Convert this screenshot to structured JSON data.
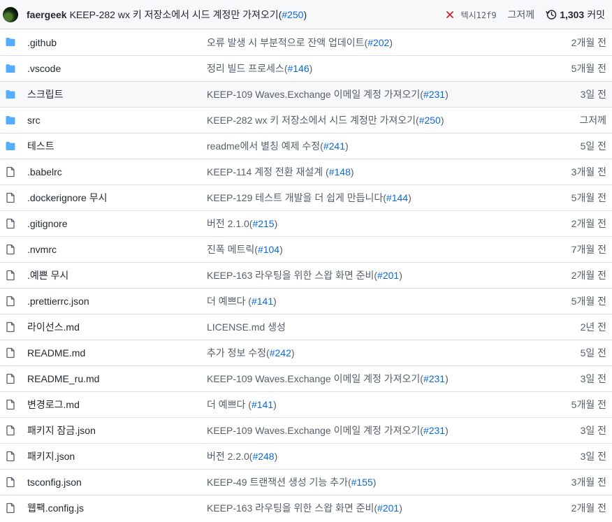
{
  "latest_commit": {
    "author": "faergeek",
    "message": "KEEP-282 wx 키 저장소에서 시드 계정만 가져오기(",
    "pr": "#250",
    "message_end": ")",
    "sha": "텍시12f9",
    "time": "그저께",
    "commit_count": "1,303",
    "commit_label": "커밋",
    "status_color": "#cf222e"
  },
  "files": [
    {
      "type": "folder",
      "icon": "folder-icon",
      "name": ".github",
      "msg": "오류 발생 시 부분적으로 잔액 업데이트(",
      "pr": "#202",
      "end": ")",
      "age": "2개월 전"
    },
    {
      "type": "folder",
      "icon": "folder-icon",
      "name": ".vscode",
      "msg": "정리 빌드 프로세스(",
      "pr": "#146",
      "end": ")",
      "age": "5개월 전"
    },
    {
      "type": "folder",
      "icon": "folder-icon",
      "name": "스크립트",
      "msg": "KEEP-109 Waves.Exchange 이메일 계정 가져오기(",
      "pr": "#231",
      "end": ")",
      "age": "3일 전"
    },
    {
      "type": "folder",
      "icon": "folder-icon",
      "name": "src",
      "msg": "KEEP-282 wx 키 저장소에서 시드 계정만 가져오기(",
      "pr": "#250",
      "end": ")",
      "age": "그저께"
    },
    {
      "type": "folder",
      "icon": "folder-icon",
      "name": "테스트",
      "msg": "readme에서 별칭 예제 수정(",
      "pr": "#241",
      "end": ")",
      "age": "5일 전"
    },
    {
      "type": "file",
      "icon": "file-icon",
      "name": ".babelrc",
      "msg": "KEEP-114 계정 전환 재설계 (",
      "pr": "#148",
      "end": ")",
      "age": "3개월 전"
    },
    {
      "type": "file",
      "icon": "file-icon",
      "name": ".dockerignore 무시",
      "msg": "KEEP-129 테스트 개발을 더 쉽게 만듭니다(",
      "pr": "#144",
      "end": ")",
      "age": "5개월 전"
    },
    {
      "type": "file",
      "icon": "file-icon",
      "name": ".gitignore",
      "msg": "버전 2.1.0(",
      "pr": "#215",
      "end": ")",
      "age": "2개월 전"
    },
    {
      "type": "file",
      "icon": "file-icon",
      "name": ".nvmrc",
      "msg": "진폭 메트릭(",
      "pr": "#104",
      "end": ")",
      "age": "7개월 전"
    },
    {
      "type": "file",
      "icon": "file-icon",
      "name": ".예쁜 무시",
      "msg": "KEEP-163 라우팅을 위한 스왑 화면 준비(",
      "pr": "#201",
      "end": ")",
      "age": "2개월 전"
    },
    {
      "type": "file",
      "icon": "file-icon",
      "name": ".prettierrc.json",
      "msg": "더 예쁘다 (",
      "pr": "#141",
      "end": ")",
      "age": "5개월 전"
    },
    {
      "type": "file",
      "icon": "file-icon",
      "name": "라이선스.md",
      "msg": "LICENSE.md 생성",
      "pr": "",
      "end": "",
      "age": "2년 전"
    },
    {
      "type": "file",
      "icon": "file-icon",
      "name": "README.md",
      "msg": "추가 정보 수정(",
      "pr": "#242",
      "end": ")",
      "age": "5일 전"
    },
    {
      "type": "file",
      "icon": "file-icon",
      "name": "README_ru.md",
      "msg": "KEEP-109 Waves.Exchange 이메일 계정 가져오기(",
      "pr": "#231",
      "end": ")",
      "age": "3일 전"
    },
    {
      "type": "file",
      "icon": "file-icon",
      "name": "변경로그.md",
      "msg": "더 예쁘다 (",
      "pr": "#141",
      "end": ")",
      "age": "5개월 전"
    },
    {
      "type": "file",
      "icon": "file-icon",
      "name": "패키지 잠금.json",
      "msg": "KEEP-109 Waves.Exchange 이메일 계정 가져오기(",
      "pr": "#231",
      "end": ")",
      "age": "3일 전"
    },
    {
      "type": "file",
      "icon": "file-icon",
      "name": "패키지.json",
      "msg": "버전 2.2.0(",
      "pr": "#248",
      "end": ")",
      "age": "3일 전"
    },
    {
      "type": "file",
      "icon": "file-icon",
      "name": "tsconfig.json",
      "msg": "KEEP-49 트랜잭션 생성 기능 추가(",
      "pr": "#155",
      "end": ")",
      "age": "3개월 전"
    },
    {
      "type": "file",
      "icon": "file-icon",
      "name": "웹팩.config.js",
      "msg": "KEEP-163 라우팅을 위한 스왑 화면 준비(",
      "pr": "#201",
      "end": ")",
      "age": "2개월 전"
    }
  ],
  "colors": {
    "folder": "#54aeff",
    "file": "#57606a",
    "link": "#0969da",
    "header_bg": "#f6f8fa"
  }
}
